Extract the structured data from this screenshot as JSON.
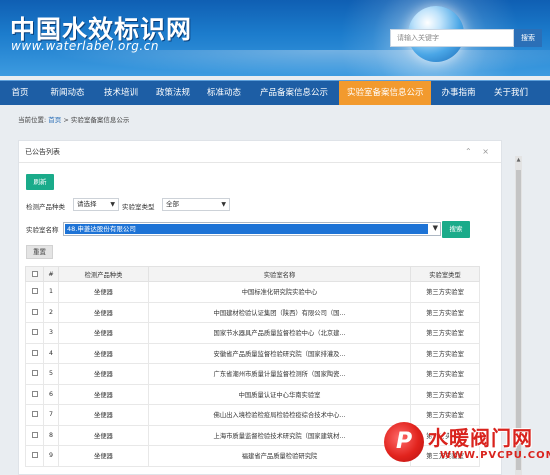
{
  "header": {
    "title": "中国水效标识网",
    "url": "www.waterlabel.org.cn",
    "search_placeholder": "请输入关键字",
    "search_button": "搜索"
  },
  "nav": {
    "items": [
      {
        "label": "首页"
      },
      {
        "label": "新闻动态"
      },
      {
        "label": "技术培训"
      },
      {
        "label": "政策法规"
      },
      {
        "label": "标准动态"
      },
      {
        "label": "产品备案信息公示"
      },
      {
        "label": "实验室备案信息公示",
        "active": true
      },
      {
        "label": "办事指南"
      },
      {
        "label": "关于我们"
      }
    ]
  },
  "breadcrumb": {
    "prefix": "当前位置:",
    "home": "首页",
    "current": "> 实验室备案信息公示"
  },
  "panel": {
    "title": "已公告列表",
    "tools": "⌃ ×",
    "refresh_button": "刷新",
    "filters": {
      "product_label": "检测产品种类",
      "product_value": "请选择",
      "lab_type_label": "实验室类型",
      "lab_type_value": "全部",
      "lab_name_label": "实验室名称",
      "lab_name_value": "48.申菱达股份有限公司",
      "search_button": "搜索",
      "reset_button": "重置"
    }
  },
  "table": {
    "headers": [
      "",
      "#",
      "检测产品种类",
      "实验室名称",
      "实验室类型"
    ],
    "rows": [
      {
        "no": "1",
        "product": "坐便器",
        "name": "中国标准化研究院实验中心",
        "type": "第三方实验室"
      },
      {
        "no": "2",
        "product": "坐便器",
        "name": "中国建材检验认证集团（陕西）有限公司（国...",
        "type": "第三方实验室"
      },
      {
        "no": "3",
        "product": "坐便器",
        "name": "国家节水器具产品质量监督检验中心（北京建...",
        "type": "第三方实验室"
      },
      {
        "no": "4",
        "product": "坐便器",
        "name": "安徽省产品质量监督检验研究院（国家排灌及...",
        "type": "第三方实验室"
      },
      {
        "no": "5",
        "product": "坐便器",
        "name": "广东省潮州市质量计量监督检测所（国家陶瓷...",
        "type": "第三方实验室"
      },
      {
        "no": "6",
        "product": "坐便器",
        "name": "中国质量认证中心华南实验室",
        "type": "第三方实验室"
      },
      {
        "no": "7",
        "product": "坐便器",
        "name": "佛山出入境检验检疫局检验检疫综合技术中心...",
        "type": "第三方实验室"
      },
      {
        "no": "8",
        "product": "坐便器",
        "name": "上海市质量监督检验技术研究院（国家建筑材...",
        "type": "第三方实验室"
      },
      {
        "no": "9",
        "product": "坐便器",
        "name": "福建省产品质量检验研究院",
        "type": "第三方实验室"
      }
    ]
  },
  "watermark": {
    "logo": "P",
    "name": "水暖阀门网",
    "url": "WWW.PVCPU.COM"
  },
  "colors": {
    "header_blue": "#1c7ccc",
    "nav_blue": "#1d5ea5",
    "nav_active": "#f29a2e",
    "green_button": "#1aab8a",
    "select_highlight": "#1d73d6"
  }
}
